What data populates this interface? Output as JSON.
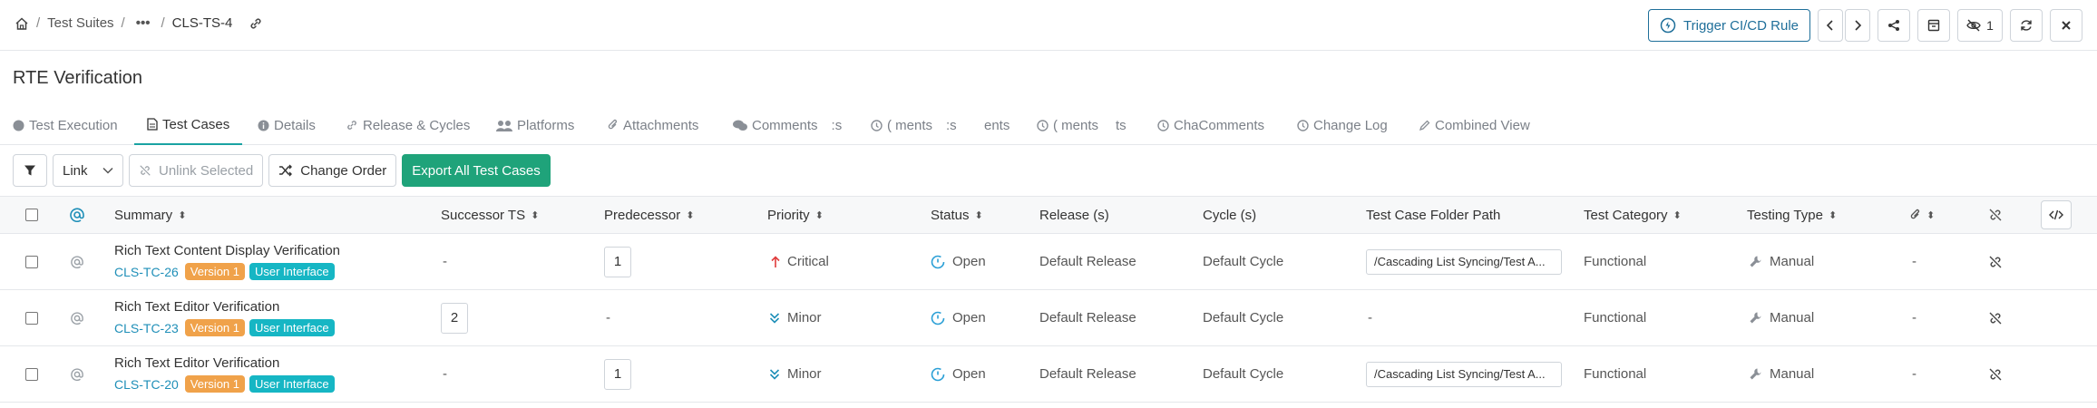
{
  "breadcrumb": {
    "home_icon": "home-icon",
    "suites": "Test Suites",
    "sep": "/",
    "more": "•••",
    "current": "CLS-TS-4",
    "link_icon": "link-icon"
  },
  "header_actions": {
    "trigger_label": "Trigger CI/CD Rule",
    "hidden_count": "1"
  },
  "page": {
    "title": "RTE Verification"
  },
  "tabs": [
    {
      "label": "Test Execution",
      "icon": "info-circle-icon"
    },
    {
      "label": "Test Cases",
      "icon": "document-icon"
    },
    {
      "label": "Details",
      "icon": "info-circle-icon"
    },
    {
      "label": "Release & Cycles",
      "icon": "link-icon"
    },
    {
      "label": "Platforms",
      "icon": "users-icon"
    },
    {
      "label": "Attachments",
      "icon": "paperclip-icon"
    },
    {
      "label": "Comments",
      "icon": "comments-icon",
      "trail": ":s"
    },
    {
      "label": "( ments",
      "icon": "info-circle-icon",
      "trail": ":s"
    },
    {
      "label": "ents",
      "icon": ""
    },
    {
      "label": "( ments",
      "icon": "info-circle-icon",
      "trail": "ts"
    },
    {
      "label": "ChaComments",
      "icon": "info-circle-icon"
    },
    {
      "label": "Change Log",
      "icon": "info-circle-icon"
    },
    {
      "label": "Combined View",
      "icon": "pencil-icon"
    }
  ],
  "toolbar": {
    "link_label": "Link",
    "unlink_label": "Unlink Selected",
    "change_order_label": "Change Order",
    "export_label": "Export All Test Cases"
  },
  "columns": {
    "summary": "Summary",
    "successor": "Successor TS",
    "predecessor": "Predecessor",
    "priority": "Priority",
    "status": "Status",
    "release": "Release (s)",
    "cycle": "Cycle (s)",
    "folder": "Test Case Folder Path",
    "category": "Test Category",
    "testing_type": "Testing Type"
  },
  "rows": [
    {
      "summary": "Rich Text Content Display Verification",
      "id": "CLS-TC-26",
      "version": "Version 1",
      "tag": "User Interface",
      "successor": "-",
      "predecessor": "1",
      "priority": "Critical",
      "status": "Open",
      "release": "Default Release",
      "cycle": "Default Cycle",
      "folder": "/Cascading List Syncing/Test A...",
      "category": "Functional",
      "testing_type": "Manual",
      "attachments": "-"
    },
    {
      "summary": "Rich Text Editor Verification",
      "id": "CLS-TC-23",
      "version": "Version 1",
      "tag": "User Interface",
      "successor": "2",
      "predecessor": "-",
      "priority": "Minor",
      "status": "Open",
      "release": "Default Release",
      "cycle": "Default Cycle",
      "folder": "-",
      "category": "Functional",
      "testing_type": "Manual",
      "attachments": "-"
    },
    {
      "summary": "Rich Text Editor Verification",
      "id": "CLS-TC-20",
      "version": "Version 1",
      "tag": "User Interface",
      "successor": "-",
      "predecessor": "1",
      "priority": "Minor",
      "status": "Open",
      "release": "Default Release",
      "cycle": "Default Cycle",
      "folder": "/Cascading List Syncing/Test A...",
      "category": "Functional",
      "testing_type": "Manual",
      "attachments": "-"
    }
  ],
  "colors": {
    "primary": "#1f6f9a",
    "accent_teal": "#1aa3a3",
    "export_green": "#1fa37a",
    "version_badge": "#f0a24a",
    "ui_badge": "#16b6c4",
    "critical": "#e03c3c",
    "minor": "#1f8fb8",
    "status_open": "#2a9fd6"
  }
}
